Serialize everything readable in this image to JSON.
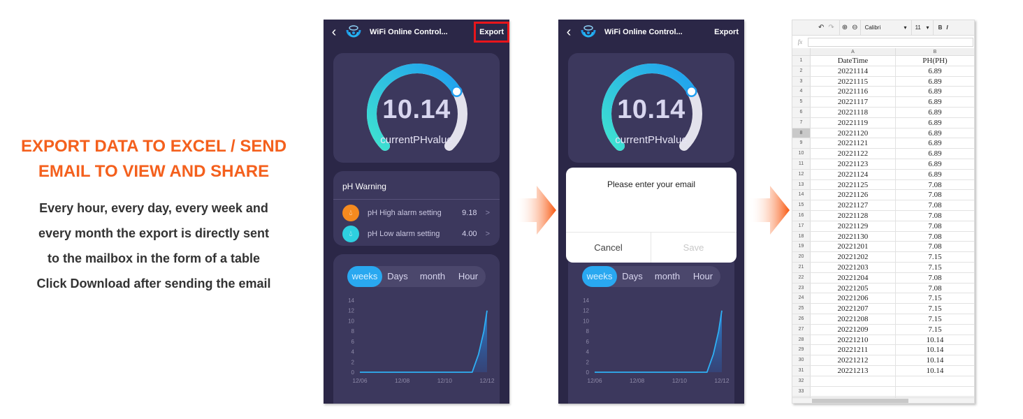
{
  "promo": {
    "title_lines": [
      "EXPORT DATA TO EXCEL / SEND",
      "EMAIL TO VIEW AND SHARE"
    ],
    "body_lines": [
      "Every hour, every day, every week and",
      "every month the export is directly sent",
      "to the mailbox in the form of a table",
      "Click Download after sending the email"
    ]
  },
  "colors": {
    "accent_orange": "#f4601d",
    "phone_bg": "#2b2747",
    "card_bg": "#3c385d",
    "accent_blue": "#29a8f0",
    "export_highlight": "#e8151b"
  },
  "app": {
    "back_icon": "chevron-left-icon",
    "logo_icon": "fish-logo-icon",
    "title": "WiFi Online Control...",
    "export_label": "Export",
    "gauge": {
      "value": "10.14",
      "label": "currentPHvalue",
      "value_fraction": 0.724
    },
    "warning": {
      "title": "pH Warning",
      "items": [
        {
          "label": "pH High alarm setting",
          "value": "9.18",
          "icon": "droplet-icon",
          "color": "#f58a1f"
        },
        {
          "label": "pH Low alarm setting",
          "value": "4.00",
          "icon": "droplet-icon",
          "color": "#2ecfe0"
        }
      ]
    },
    "tabs": [
      {
        "label": "weeks",
        "active": true
      },
      {
        "label": "Days",
        "active": false
      },
      {
        "label": "month",
        "active": false
      },
      {
        "label": "Hour",
        "active": false
      }
    ]
  },
  "dialog": {
    "title": "Please enter your email",
    "cancel_label": "Cancel",
    "save_label": "Save"
  },
  "chart_data": {
    "type": "area",
    "title": "",
    "xlabel": "",
    "ylabel": "",
    "x_ticks": [
      "12/06",
      "12/08",
      "12/10",
      "12/12"
    ],
    "y_ticks": [
      0,
      2,
      4,
      6,
      8,
      10,
      12,
      14
    ],
    "ylim": [
      0,
      14
    ],
    "xlim": [
      0,
      6
    ],
    "grid": false,
    "series": [
      {
        "name": "pH",
        "x": [
          0,
          1,
          2,
          3,
          4,
          5.3,
          5.6,
          5.85,
          6
        ],
        "y": [
          0,
          0,
          0,
          0,
          0,
          0,
          3.5,
          8,
          12
        ]
      }
    ]
  },
  "spreadsheet": {
    "toolbar": {
      "undo_icon": "undo-icon",
      "redo_icon": "redo-icon",
      "zoom_in_icon": "zoom-in-icon",
      "zoom_out_icon": "zoom-out-icon",
      "font": "Calibri",
      "size": "11",
      "bold": "B",
      "italic": "I"
    },
    "fx_label": "fx",
    "columns": [
      "A",
      "B"
    ],
    "selected_row": 8,
    "rows": [
      [
        "DateTime",
        "PH(PH)"
      ],
      [
        "20221114",
        "6.89"
      ],
      [
        "20221115",
        "6.89"
      ],
      [
        "20221116",
        "6.89"
      ],
      [
        "20221117",
        "6.89"
      ],
      [
        "20221118",
        "6.89"
      ],
      [
        "20221119",
        "6.89"
      ],
      [
        "20221120",
        "6.89"
      ],
      [
        "20221121",
        "6.89"
      ],
      [
        "20221122",
        "6.89"
      ],
      [
        "20221123",
        "6.89"
      ],
      [
        "20221124",
        "6.89"
      ],
      [
        "20221125",
        "7.08"
      ],
      [
        "20221126",
        "7.08"
      ],
      [
        "20221127",
        "7.08"
      ],
      [
        "20221128",
        "7.08"
      ],
      [
        "20221129",
        "7.08"
      ],
      [
        "20221130",
        "7.08"
      ],
      [
        "20221201",
        "7.08"
      ],
      [
        "20221202",
        "7.15"
      ],
      [
        "20221203",
        "7.15"
      ],
      [
        "20221204",
        "7.08"
      ],
      [
        "20221205",
        "7.08"
      ],
      [
        "20221206",
        "7.15"
      ],
      [
        "20221207",
        "7.15"
      ],
      [
        "20221208",
        "7.15"
      ],
      [
        "20221209",
        "7.15"
      ],
      [
        "20221210",
        "10.14"
      ],
      [
        "20221211",
        "10.14"
      ],
      [
        "20221212",
        "10.14"
      ],
      [
        "20221213",
        "10.14"
      ],
      [
        "",
        ""
      ],
      [
        "",
        ""
      ],
      [
        "",
        ""
      ]
    ]
  }
}
